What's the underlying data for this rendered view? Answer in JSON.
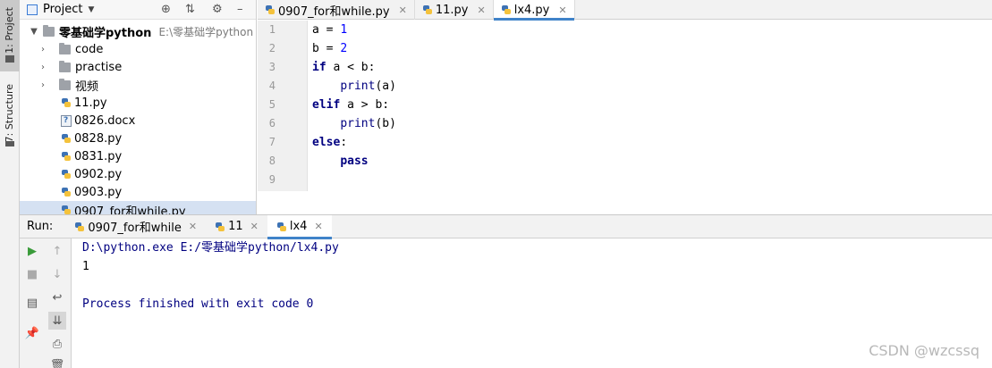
{
  "toolstrip": {
    "project_tab": "1: Project",
    "structure_tab": "7: Structure"
  },
  "project_panel": {
    "title": "Project",
    "root": {
      "name": "零基础学python",
      "path": "E:\\零基础学python"
    },
    "folders": [
      "code",
      "practise",
      "视频"
    ],
    "files": [
      "11.py",
      "0826.docx",
      "0828.py",
      "0831.py",
      "0902.py",
      "0903.py",
      "0907_for和while.py"
    ]
  },
  "editor": {
    "tabs": [
      {
        "label": "0907_for和while.py"
      },
      {
        "label": "11.py"
      },
      {
        "label": "lx4.py"
      }
    ],
    "line_numbers": [
      "1",
      "2",
      "3",
      "4",
      "5",
      "6",
      "7",
      "8",
      "9"
    ],
    "code": {
      "l1_var": "a",
      "l1_op": " = ",
      "l1_val": "1",
      "l2_var": "b",
      "l2_op": " = ",
      "l2_val": "2",
      "l3_kw": "if",
      "l3_rest": " a < b:",
      "l4_indent": "    ",
      "l4_fn": "print",
      "l4_rest": "(a)",
      "l5_kw": "elif",
      "l5_rest": " a > b:",
      "l6_indent": "    ",
      "l6_fn": "print",
      "l6_rest": "(b)",
      "l7_kw": "else",
      "l7_rest": ":",
      "l8_indent": "    ",
      "l8_kw": "pass"
    }
  },
  "run_panel": {
    "label": "Run:",
    "tabs": [
      {
        "label": "0907_for和while"
      },
      {
        "label": "11"
      },
      {
        "label": "lx4"
      }
    ],
    "output": {
      "command": "D:\\python.exe E:/零基础学python/lx4.py",
      "result": "1",
      "finished": "Process finished with exit code 0"
    }
  },
  "colors": {
    "keyword": "#000080",
    "number": "#0000ff",
    "console_text": "#000080",
    "selection": "#d5e1f2",
    "tab_accent": "#4083c9"
  },
  "watermark": "CSDN @wzcssq"
}
